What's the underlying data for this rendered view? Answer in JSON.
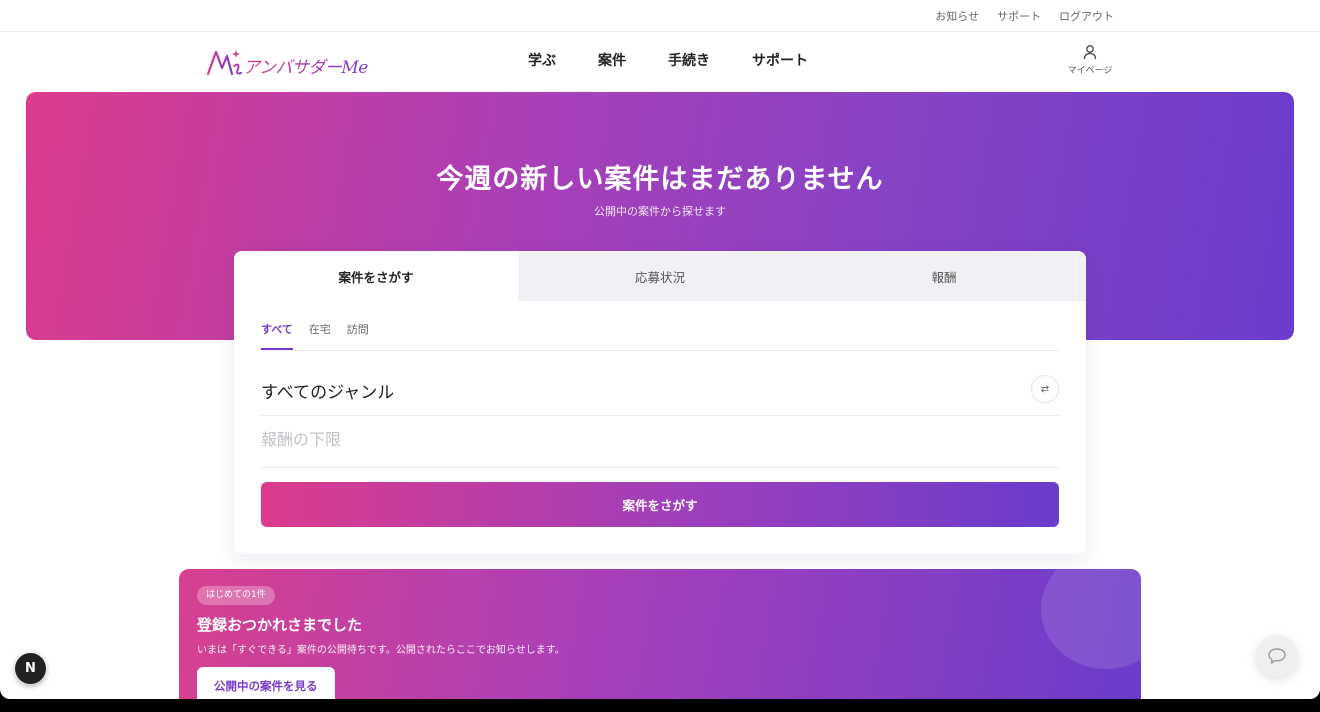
{
  "util_links": [
    "お知らせ",
    "サポート",
    "ログアウト"
  ],
  "logo": {
    "mark": "Me",
    "text": "アンバサダーMe"
  },
  "nav": [
    "学ぶ",
    "案件",
    "手続き",
    "サポート"
  ],
  "mypage_label": "マイページ",
  "hero": {
    "title": "今週の新しい案件はまだありません",
    "subtitle": "公開中の案件から探せます"
  },
  "search_card": {
    "tabs": [
      "案件をさがす",
      "応募状況",
      "報酬"
    ],
    "active_tab": 0,
    "subtabs": [
      "すべて",
      "在宅",
      "訪問"
    ],
    "active_subtab": 0,
    "genre_label": "すべてのジャンル",
    "swap_icon_glyph": "⇄",
    "reward_placeholder": "報酬の下限",
    "search_button": "案件をさがす"
  },
  "banner": {
    "badge": "はじめての1件",
    "title": "登録おつかれさまでした",
    "text": "いまは「すぐできる」案件の公開待ちです。公開されたらここでお知らせします。",
    "button": "公開中の案件を見る"
  },
  "dev_badge": "N",
  "colors": {
    "accent_pink": "#db3b8c",
    "accent_purple": "#6a3ccb",
    "active_tab_text": "#7a3cc8"
  }
}
